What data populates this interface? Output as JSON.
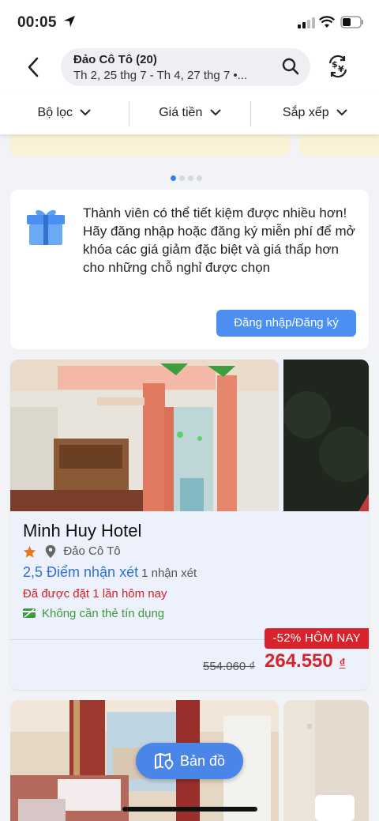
{
  "status_bar": {
    "time": "00:05"
  },
  "header": {
    "destination": "Đảo Cô Tô",
    "count": "(20)",
    "dates": "Th 2, 25 thg 7 - Th 4, 27 thg 7 •..."
  },
  "filters": [
    {
      "label": "Bộ lọc"
    },
    {
      "label": "Giá tiền"
    },
    {
      "label": "Sắp xếp"
    }
  ],
  "promo": {
    "text": "Thành viên có thể tiết kiệm được nhiều hơn! Hãy đăng nhập hoặc đăng ký miễn phí để mở khóa các giá giảm đặc biệt và giá thấp hơn cho những chỗ nghỉ được chọn",
    "button": "Đăng nhập/Đăng ký"
  },
  "hotel": {
    "name": "Minh Huy Hotel",
    "location": "Đảo Cô Tô",
    "score": "2,5 Điểm nhận xét",
    "review_count": "1 nhận xét",
    "booked": "Đã được đặt 1 lần hôm nay",
    "no_card": "Không cần thẻ tín dụng",
    "deal": "-52% HÔM NAY",
    "old_price": "554.060 ₫",
    "price": "264.550",
    "currency": "₫"
  },
  "map_button": "Bản đồ",
  "colors": {
    "accent": "#4a8ff1",
    "price_red": "#d8232c",
    "green": "#3d9a3d",
    "rating_star": "#e8741c"
  }
}
